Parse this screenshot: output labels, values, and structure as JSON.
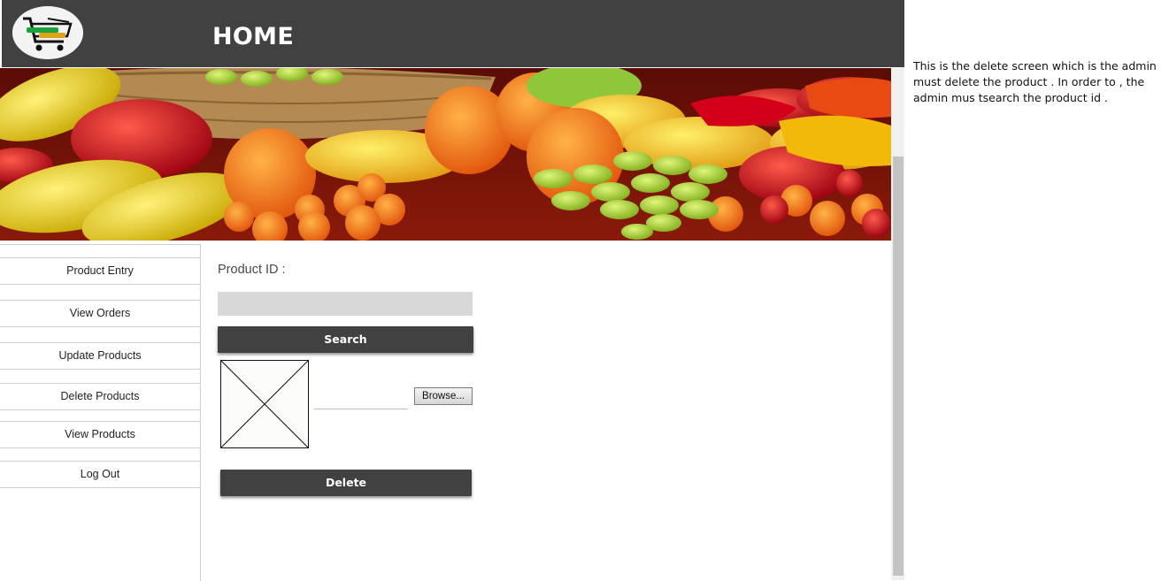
{
  "header": {
    "title": "HOME",
    "logo_icon": "shopping-cart-logo-icon",
    "bg_color": "#414141"
  },
  "banner": {
    "image": "fruit-banner-image"
  },
  "sidebar": {
    "items": [
      {
        "label": "Product Entry"
      },
      {
        "label": "View Orders"
      },
      {
        "label": "Update Products"
      },
      {
        "label": "Delete Products"
      },
      {
        "label": "View Products"
      },
      {
        "label": "Log Out"
      }
    ]
  },
  "form": {
    "product_id_label": "Product ID :",
    "product_id_value": "",
    "search_label": "Search",
    "browse_label": "Browse...",
    "image_placeholder_icon": "image-placeholder-icon",
    "delete_label": "Delete"
  },
  "note": {
    "text": "This is the delete screen which is the admin must delete the product . In order to , the admin mus tsearch the product id ."
  }
}
